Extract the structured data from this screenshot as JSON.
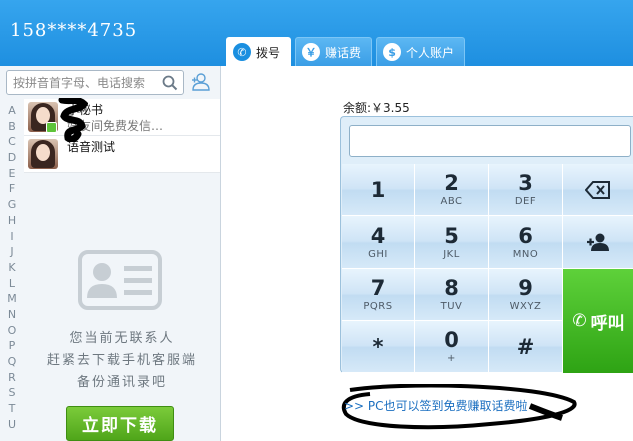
{
  "header": {
    "phone_number": "158****4735",
    "tabs": [
      {
        "label": "拨号",
        "icon": "phone-icon",
        "active": true
      },
      {
        "label": "赚话费",
        "icon": "money-bag-icon",
        "active": false
      },
      {
        "label": "个人账户",
        "icon": "dollar-icon",
        "active": false
      }
    ]
  },
  "sidebar": {
    "search_placeholder": "按拼音首字母、电话搜索",
    "alphabet": [
      "A",
      "B",
      "C",
      "D",
      "E",
      "F",
      "G",
      "H",
      "I",
      "J",
      "K",
      "L",
      "M",
      "N",
      "O",
      "P",
      "Q",
      "R",
      "S",
      "T",
      "U"
    ],
    "contacts": [
      {
        "name": "小秘书",
        "subtitle": "好友间免费发信…"
      },
      {
        "name": "语音测试",
        "subtitle": ""
      }
    ],
    "empty_lines": [
      "您当前无联系人",
      "赶紧去下载手机客服端",
      "备份通讯录吧"
    ],
    "download_label": "立即下载"
  },
  "dialer": {
    "balance_label": "余额:￥3.55",
    "number_value": "",
    "keys": [
      {
        "digit": "1",
        "letters": ""
      },
      {
        "digit": "2",
        "letters": "ABC"
      },
      {
        "digit": "3",
        "letters": "DEF"
      },
      {
        "digit": "4",
        "letters": "GHI"
      },
      {
        "digit": "5",
        "letters": "JKL"
      },
      {
        "digit": "6",
        "letters": "MNO"
      },
      {
        "digit": "7",
        "letters": "PQRS"
      },
      {
        "digit": "8",
        "letters": "TUV"
      },
      {
        "digit": "9",
        "letters": "WXYZ"
      },
      {
        "digit": "*",
        "letters": ""
      },
      {
        "digit": "0",
        "letters": "+"
      },
      {
        "digit": "#",
        "letters": ""
      }
    ],
    "call_label": "呼叫",
    "link_text": ">> PC也可以签到免费赚取话费啦"
  },
  "colors": {
    "header_blue": "#1e8fe0",
    "call_green": "#2ea314",
    "download_green": "#4fa51a",
    "link_blue": "#1b6fc0"
  }
}
